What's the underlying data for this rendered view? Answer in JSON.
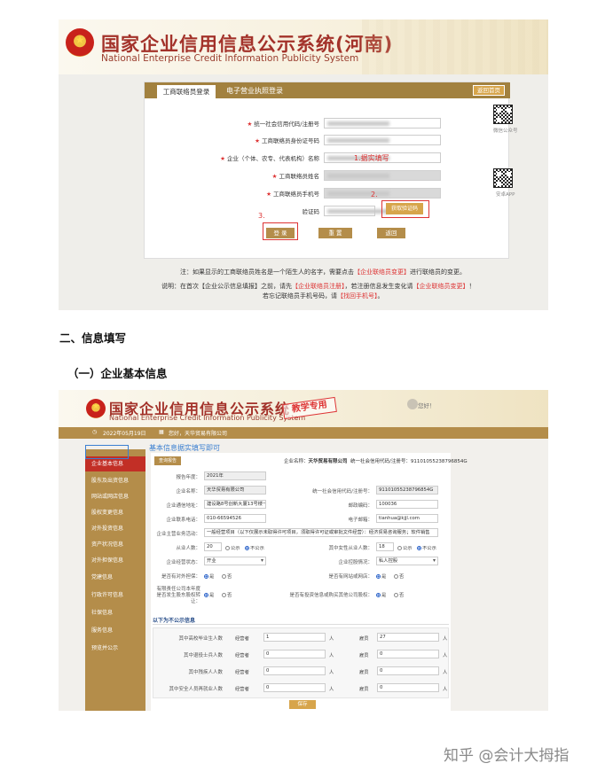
{
  "shot1": {
    "site_title": "国家企业信用信息公示系统(河南)",
    "site_subtitle": "National Enterprise Credit Information Publicity System",
    "tab_active": "工商联络员登录",
    "tab_inactive": "电子营业执照登录",
    "home_button": "返回首页",
    "fields": [
      {
        "label": "统一社会信用代码/注册号"
      },
      {
        "label": "工商联络员身份证号码"
      },
      {
        "label": "企业（个体、农专、代表机构）名称"
      },
      {
        "label": "工商联络员姓名"
      },
      {
        "label": "工商联络员手机号"
      },
      {
        "label": "验证码"
      }
    ],
    "annotation_fill": "1.据实填写",
    "annotation_2": "2.",
    "annotation_3": "3.",
    "get_code_button": "获取验证码",
    "buttons": {
      "login": "登 录",
      "reset": "重 置",
      "back": "返回"
    },
    "qr1_caption": "微信公众号",
    "qr2_caption": "安卓APP",
    "note_line1_a": "注：如果显示的工商联络员姓名是一个陌生人的名字，需要点击",
    "note_line1_link": "【企业联络员变更】",
    "note_line1_b": "进行联络员的变更。",
    "note_line2_a": "说明：在首次【企业公示信息填报】之前，请先",
    "note_line2_link1": "【企业联络员注册】",
    "note_line2_b": "，若注册信息发生变化请",
    "note_line2_link2": "【企业联络员变更】",
    "note_line2_c": "！",
    "note_line3_a": "若忘记联络员手机号码，请",
    "note_line3_link": "【找回手机号】",
    "note_line3_b": "。"
  },
  "heading_2": "二、信息填写",
  "heading_3": "（一）企业基本信息",
  "shot2": {
    "site_title": "国家企业信用信息公示系统",
    "site_subtitle": "National Enterprise Credit Information Publicity System",
    "stamp": "教学专用",
    "user": "您好！",
    "info_date": "2022年05月19日",
    "info_company": "您好，天华贸易有限公司",
    "sidebar": [
      "企业基本信息",
      "股东及出资信息",
      "网站或网店信息",
      "股权变更信息",
      "对外投资信息",
      "资产状况信息",
      "对外担保信息",
      "党建信息",
      "行政许可信息",
      "社保信息",
      "服务信息",
      "预览并公示"
    ],
    "sidebar_annotation": "基本信息据实填写即可",
    "query_button": "查询报告",
    "company_header_label": "企业名称：",
    "company_header_name": "天华贸易有限公司",
    "company_header_code": "统一社会信用代码/注册号：91101055238796854G",
    "form": {
      "year_label": "报告年度：",
      "year": "2021年",
      "name_label": "企业名称：",
      "name": "天华贸易有限公司",
      "code_label": "统一社会信用代码/注册号：",
      "code": "91101055238796854G",
      "address_label": "企业通信地址：",
      "address": "建设路8号创新大厦13号楼一层",
      "zip_label": "邮政编码：",
      "zip": "100036",
      "phone_label": "企业联系电话：",
      "phone": "010-66594526",
      "email_label": "电子邮箱：",
      "email": "tianhua@kjjl.com",
      "business_label": "企业主营业务活动：",
      "business": "一般经营项目（以下仅展示未取得许可项目，须取得许可证或审批文件经营）：经济贸易咨询服务；软件销售",
      "employees_label": "从业人数：",
      "employees": "20",
      "female_label": "其中女性从业人数：",
      "female": "18",
      "public": "公示",
      "not_public": "不公示",
      "status_label": "企业经营状态：",
      "status": "开业",
      "holding_label": "企业控股情况：",
      "holding": "私人控股",
      "guarantee_label": "是否有对外担保：",
      "website_label": "是否有网站或网店：",
      "transfer_label": "有限责任公司本年度是否发生股东股权转让：",
      "invest_label": "是否有投资信息或购买其他公司股权：",
      "yes": "是",
      "no": "否"
    },
    "section_title": "以下为不公示信息",
    "sub_rows": [
      {
        "label": "其中高校毕业生人数",
        "role": "经营者",
        "v1": "1",
        "role2": "雇员",
        "v2": "27"
      },
      {
        "label": "其中退役士兵人数",
        "role": "经营者",
        "v1": "0",
        "role2": "雇员",
        "v2": "0"
      },
      {
        "label": "其中残疾人人数",
        "role": "经营者",
        "v1": "0",
        "role2": "雇员",
        "v2": "0"
      },
      {
        "label": "其中安全人员再就业人数",
        "role": "经营者",
        "v1": "0",
        "role2": "雇员",
        "v2": "0"
      }
    ],
    "unit": "人",
    "save_button": "保存"
  },
  "watermark": "知乎 @会计大拇指",
  "colors": {
    "gold": "#b48d4a",
    "red": "#c22f26",
    "annotation_red": "#dd3333",
    "annotation_blue": "#3b7fd1"
  }
}
